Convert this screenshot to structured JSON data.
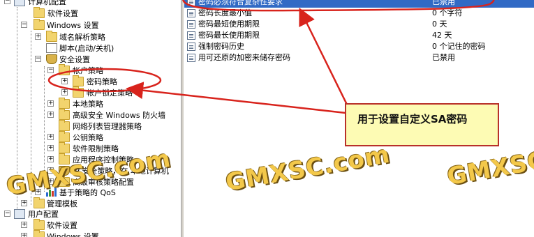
{
  "tree": {
    "computer_config": "计算机配置",
    "software_settings": "软件设置",
    "windows_settings": "Windows 设置",
    "dns_policy": "域名解析策略",
    "scripts": "脚本(启动/关机)",
    "security_settings": "安全设置",
    "account_policies": "帐户策略",
    "password_policy": "密码策略",
    "account_lockout": "帐户锁定策略",
    "local_policies": "本地策略",
    "firewall": "高级安全 Windows 防火墙",
    "network_list": "网络列表管理器策略",
    "public_key": "公钥策略",
    "software_restriction": "软件限制策略",
    "app_control": "应用程序控制策略",
    "ip_security": "IP 安全策略，在 本地计算机",
    "audit_policy": "高级审核策略配置",
    "qos": "基于策略的 QoS",
    "admin_templates": "管理模板",
    "user_config": "用户配置",
    "user_software": "软件设置",
    "user_windows": "Windows 设置"
  },
  "policies": [
    {
      "name": "密码必须符合复杂性要求",
      "value": "已禁用",
      "selected": true
    },
    {
      "name": "密码长度最小值",
      "value": "0 个字符",
      "selected": false
    },
    {
      "name": "密码最短使用期限",
      "value": "0 天",
      "selected": false
    },
    {
      "name": "密码最长使用期限",
      "value": "42 天",
      "selected": false
    },
    {
      "name": "强制密码历史",
      "value": "0 个记住的密码",
      "selected": false
    },
    {
      "name": "用可还原的加密来储存密码",
      "value": "已禁用",
      "selected": false
    }
  ],
  "callout": {
    "text": "用于设置自定义SA密码"
  },
  "watermark": {
    "text": "GMXSC.com",
    "text_right": "GMXSC"
  },
  "colors": {
    "selection": "#316ac5",
    "annotation_red": "#d8231c",
    "callout_bg": "#fdfbb4",
    "watermark": "#f3c84a"
  }
}
